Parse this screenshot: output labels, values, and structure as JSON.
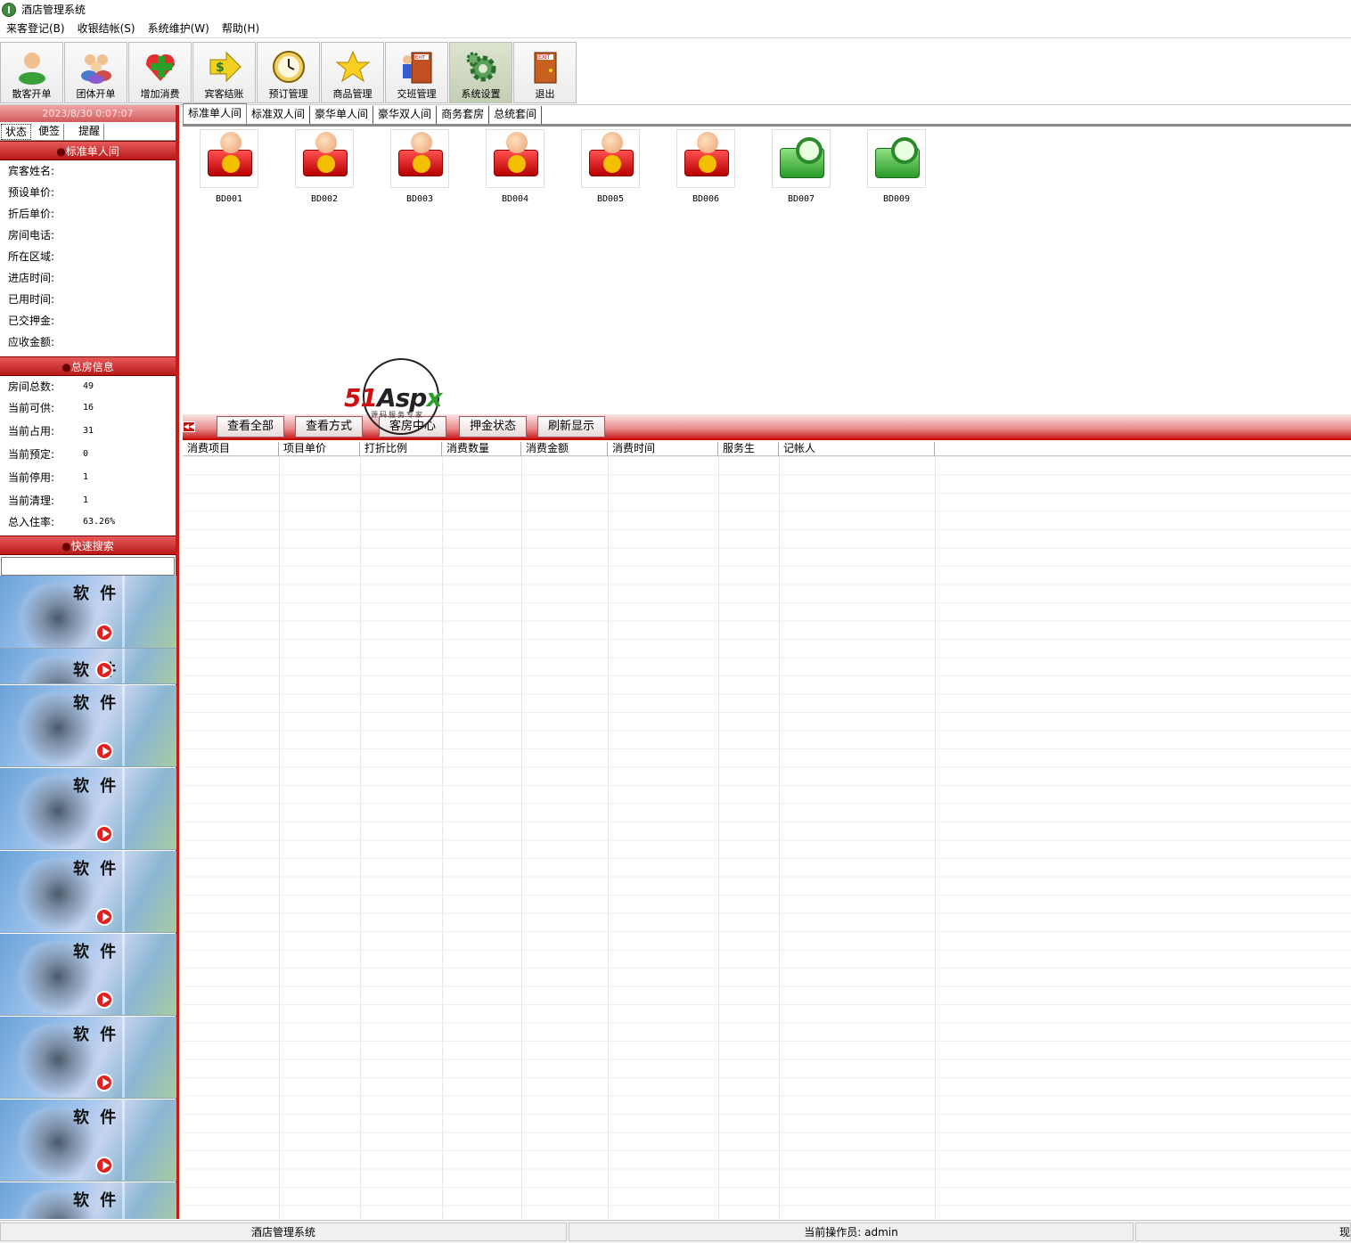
{
  "window": {
    "title": "酒店管理系统"
  },
  "menu": [
    "来客登记(B)",
    "收银结帐(S)",
    "系统维护(W)",
    "帮助(H)"
  ],
  "toolbar": {
    "buttons": [
      {
        "label": "散客开单",
        "icon": "single-guest-icon"
      },
      {
        "label": "团体开单",
        "icon": "group-guest-icon"
      },
      {
        "label": "增加消费",
        "icon": "add-consumption-icon"
      },
      {
        "label": "宾客结账",
        "icon": "checkout-icon"
      },
      {
        "label": "预订管理",
        "icon": "clock-icon"
      },
      {
        "label": "商品管理",
        "icon": "star-icon"
      },
      {
        "label": "交班管理",
        "icon": "shift-exit-icon"
      },
      {
        "label": "系统设置",
        "icon": "gear-icon"
      },
      {
        "label": "退出",
        "icon": "exit-door-icon"
      }
    ]
  },
  "left": {
    "datetime": "2023/8/30 0:07:07",
    "tabs": [
      "状态",
      "便签",
      "提醒"
    ],
    "room_section": {
      "title": "标准单人间",
      "fields": [
        "宾客姓名:",
        "预设单价:",
        "折后单价:",
        "房间电话:",
        "所在区域:",
        "进店时间:",
        "已用时间:",
        "已交押金:",
        "应收金额:"
      ]
    },
    "summary": {
      "title": "总房信息",
      "rows": [
        {
          "label": "房间总数:",
          "value": "49"
        },
        {
          "label": "当前可供:",
          "value": "16"
        },
        {
          "label": "当前占用:",
          "value": "31"
        },
        {
          "label": "当前预定:",
          "value": "0"
        },
        {
          "label": "当前停用:",
          "value": "1"
        },
        {
          "label": "当前清理:",
          "value": "1"
        },
        {
          "label": "总入住率:",
          "value": "63.26%"
        }
      ]
    },
    "search": {
      "title": "快速搜索",
      "value": ""
    },
    "tile_text": "软 件"
  },
  "room_tabs": [
    "标准单人间",
    "标准双人间",
    "豪华单人间",
    "豪华双人间",
    "商务套房",
    "总统套间"
  ],
  "rooms": [
    {
      "name": "BD001",
      "status": "occupied"
    },
    {
      "name": "BD002",
      "status": "occupied"
    },
    {
      "name": "BD003",
      "status": "occupied"
    },
    {
      "name": "BD004",
      "status": "occupied"
    },
    {
      "name": "BD005",
      "status": "occupied"
    },
    {
      "name": "BD006",
      "status": "occupied"
    },
    {
      "name": "BD007",
      "status": "available"
    },
    {
      "name": "BD009",
      "status": "available"
    }
  ],
  "watermark": {
    "brand_a": "51",
    "brand_b": "Asp",
    "brand_c": "x",
    "sub": "源码服务专家"
  },
  "actions": [
    "查看全部",
    "查看方式",
    "客房中心",
    "押金状态",
    "刷新显示"
  ],
  "grid": {
    "columns": [
      "消费项目",
      "项目单价",
      "打折比例",
      "消费数量",
      "消费金额",
      "消费时间",
      "服务生",
      "记帐人"
    ]
  },
  "status": {
    "app": "酒店管理系统",
    "operator": "当前操作员: admin",
    "right": "现"
  },
  "colors": {
    "accent": "#c91a1a",
    "occupied": "#d01010",
    "available": "#2a9a2a"
  }
}
